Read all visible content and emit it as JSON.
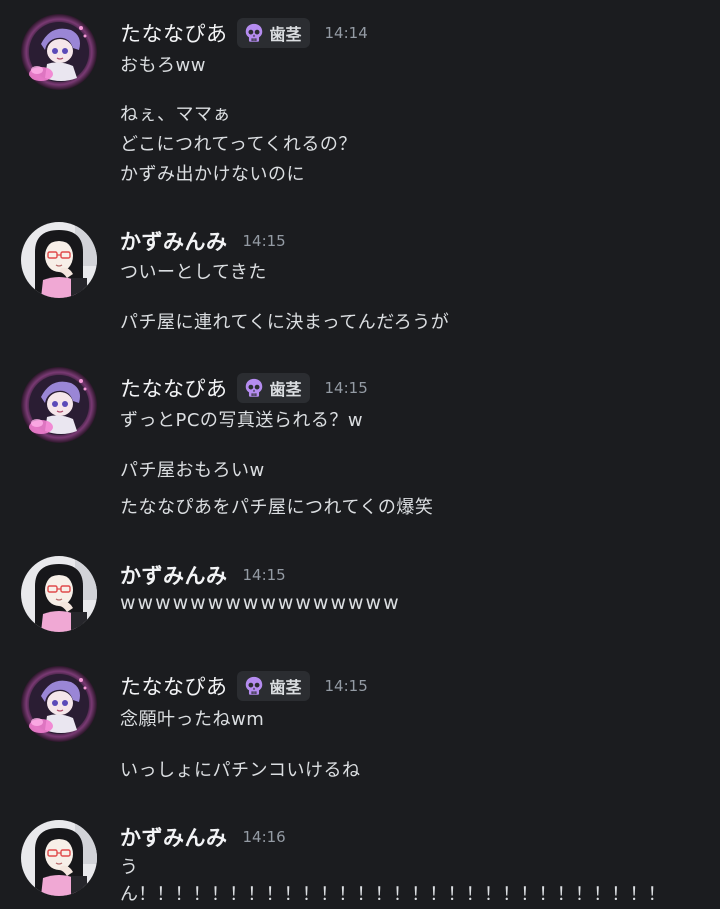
{
  "colors": {
    "background": "#1b1c1f",
    "text": "#dbdee1",
    "username": "#f2f3f5",
    "timestamp": "#949ba4",
    "tag_background": "#2b2d31",
    "tag_skull": "#b58cf0"
  },
  "messages": [
    {
      "author": "たななぴあ",
      "tag": {
        "icon": "skull-icon",
        "label": "歯茎"
      },
      "time": "14:14",
      "lines": [
        "おもろww",
        "ねぇ、ママぁ",
        "どこにつれてってくれるの？",
        "かずみ出かけないのに"
      ]
    },
    {
      "author": "かずみんみ",
      "time": "14:15",
      "lines": [
        "ついーとしてきた",
        "パチ屋に連れてくに決まってんだろうが"
      ]
    },
    {
      "author": "たななぴあ",
      "tag": {
        "icon": "skull-icon",
        "label": "歯茎"
      },
      "time": "14:15",
      "lines": [
        "ずっとPCの写真送られる？w",
        "パチ屋おもろいw",
        "たななぴあをパチ屋につれてくの爆笑"
      ]
    },
    {
      "author": "かずみんみ",
      "time": "14:15",
      "lines": [
        "wwwwwwwwwwwwwwww"
      ]
    },
    {
      "author": "たななぴあ",
      "tag": {
        "icon": "skull-icon",
        "label": "歯茎"
      },
      "time": "14:15",
      "lines": [
        "念願叶ったねwm",
        "いっしょにパチンコいけるね"
      ]
    },
    {
      "author": "かずみんみ",
      "time": "14:16",
      "lines": [
        "う",
        "ん！！！！！！！！！！！！！！！！！！！！！！！！！！！！！"
      ]
    }
  ]
}
